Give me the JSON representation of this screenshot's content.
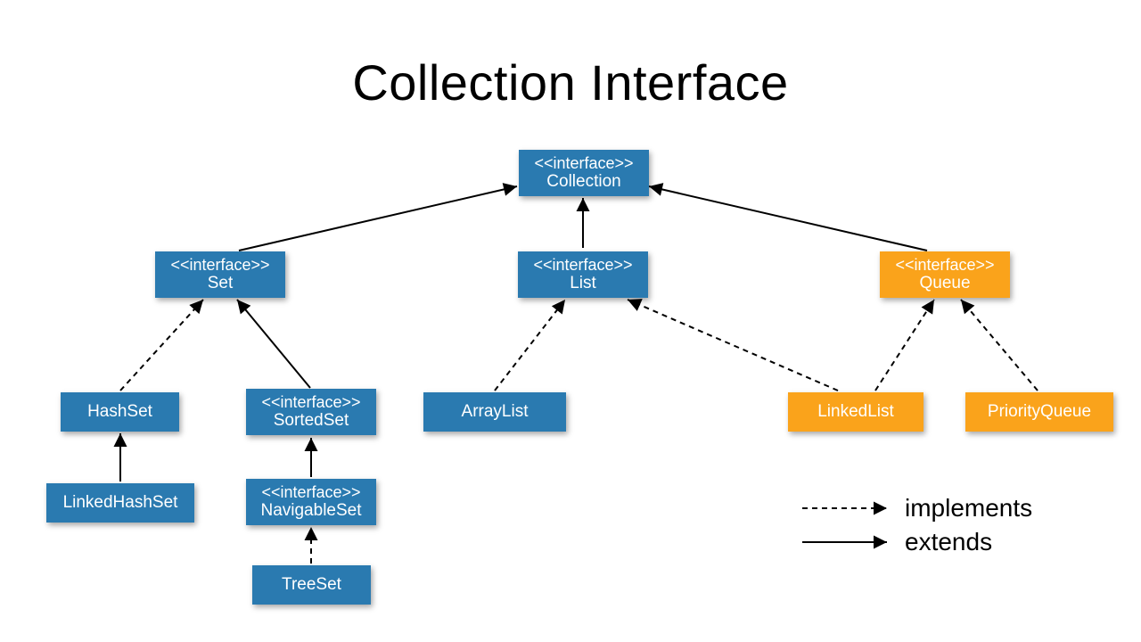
{
  "title": "Collection Interface",
  "stereotype": "<<interface>>",
  "nodes": {
    "collection": "Collection",
    "set": "Set",
    "list": "List",
    "queue": "Queue",
    "hashset": "HashSet",
    "sortedset": "SortedSet",
    "arraylist": "ArrayList",
    "linkedlist": "LinkedList",
    "priorityqueue": "PriorityQueue",
    "linkedhashset": "LinkedHashSet",
    "navigableset": "NavigableSet",
    "treeset": "TreeSet"
  },
  "legend": {
    "implements": "implements",
    "extends": "extends"
  },
  "colors": {
    "blue": "#2a7ab0",
    "orange": "#faa31b"
  },
  "edges": [
    {
      "from": "set",
      "to": "collection",
      "style": "solid"
    },
    {
      "from": "list",
      "to": "collection",
      "style": "solid"
    },
    {
      "from": "queue",
      "to": "collection",
      "style": "solid"
    },
    {
      "from": "hashset",
      "to": "set",
      "style": "dashed"
    },
    {
      "from": "sortedset",
      "to": "set",
      "style": "solid"
    },
    {
      "from": "arraylist",
      "to": "list",
      "style": "dashed"
    },
    {
      "from": "linkedlist",
      "to": "list",
      "style": "dashed"
    },
    {
      "from": "linkedlist",
      "to": "queue",
      "style": "dashed"
    },
    {
      "from": "priorityqueue",
      "to": "queue",
      "style": "dashed"
    },
    {
      "from": "linkedhashset",
      "to": "hashset",
      "style": "solid"
    },
    {
      "from": "navigableset",
      "to": "sortedset",
      "style": "solid"
    },
    {
      "from": "treeset",
      "to": "navigableset",
      "style": "dashed"
    }
  ]
}
